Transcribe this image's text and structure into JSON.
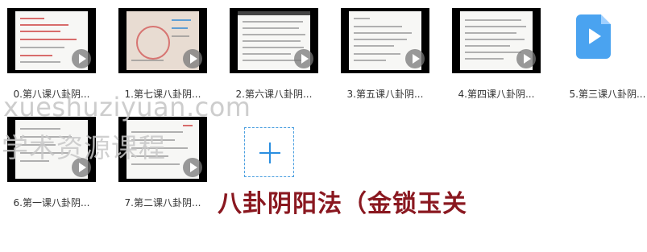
{
  "files": [
    {
      "name": "0.第八课八卦阴..."
    },
    {
      "name": "1.第七课八卦阴..."
    },
    {
      "name": "2.第六课八卦阴..."
    },
    {
      "name": "3.第五课八卦阴..."
    },
    {
      "name": "4.第四课八卦阴..."
    },
    {
      "name": "5.第三课八卦阴..."
    },
    {
      "name": "6.第一课八卦阴..."
    },
    {
      "name": "7.第二课八卦阴..."
    }
  ],
  "watermark": {
    "line1": "xueshuziyuan.com",
    "line2": "学术资源课程"
  },
  "overlay_title": "八卦阴阳法（金锁玉关",
  "colors": {
    "accent": "#2a8ee0",
    "title": "#8a1820"
  }
}
